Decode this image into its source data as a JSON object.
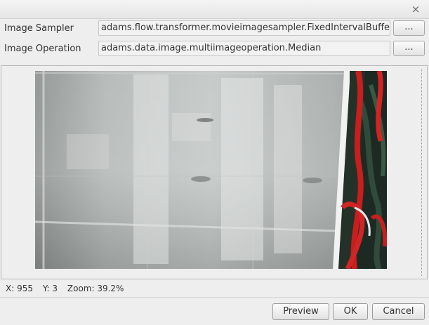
{
  "window": {
    "close_glyph": "×"
  },
  "rows": [
    {
      "label": "Image Sampler",
      "value": "adams.flow.transformer.movieimagesampler.FixedIntervalBufferedI",
      "button": "..."
    },
    {
      "label": "Image Operation",
      "value": "adams.data.image.multiimageoperation.Median",
      "button": "..."
    }
  ],
  "status": {
    "x": "X: 955",
    "y": "Y: 3",
    "zoom": "Zoom: 39.2%"
  },
  "buttons": {
    "preview": "Preview",
    "ok": "OK",
    "cancel": "Cancel"
  },
  "colors": {
    "background": "#eeeeee",
    "panel_border": "#b8b8b8"
  }
}
